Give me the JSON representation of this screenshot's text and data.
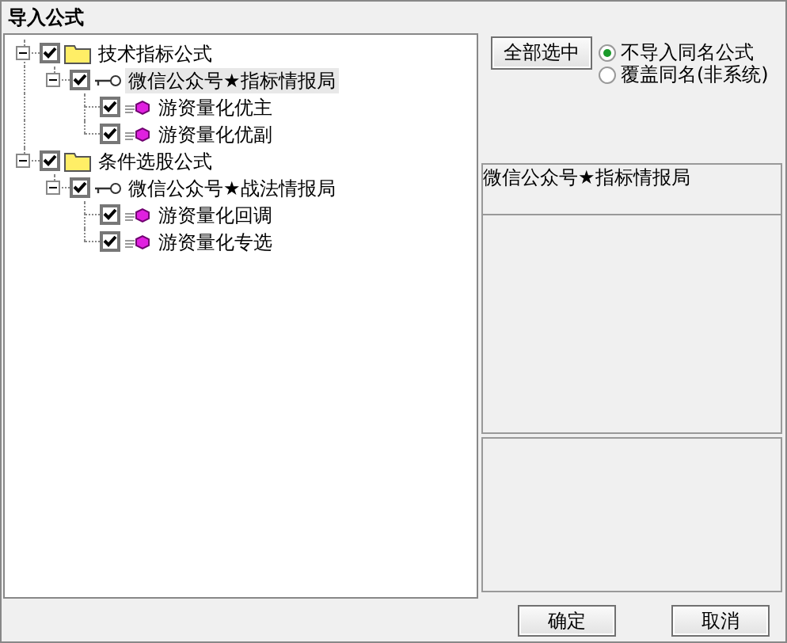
{
  "window": {
    "title": "导入公式"
  },
  "tree": [
    {
      "label": "技术指标公式",
      "kind": "folder",
      "checked": true,
      "expanded": true,
      "selected": false,
      "children": [
        {
          "label": "微信公众号★指标情报局",
          "kind": "group",
          "checked": true,
          "expanded": true,
          "selected": true,
          "children": [
            {
              "label": "游资量化优主",
              "kind": "formula",
              "checked": true,
              "selected": false
            },
            {
              "label": "游资量化优副",
              "kind": "formula",
              "checked": true,
              "selected": false
            }
          ]
        }
      ]
    },
    {
      "label": "条件选股公式",
      "kind": "folder",
      "checked": true,
      "expanded": true,
      "selected": false,
      "children": [
        {
          "label": "微信公众号★战法情报局",
          "kind": "group",
          "checked": true,
          "expanded": true,
          "selected": false,
          "children": [
            {
              "label": "游资量化回调",
              "kind": "formula",
              "checked": true,
              "selected": false
            },
            {
              "label": "游资量化专选",
              "kind": "formula",
              "checked": true,
              "selected": false
            }
          ]
        }
      ]
    }
  ],
  "select_all_button": "全部选中",
  "options": [
    {
      "label": "不导入同名公式",
      "selected": true
    },
    {
      "label": "覆盖同名(非系统)",
      "selected": false
    }
  ],
  "info_title": "微信公众号★指标情报局",
  "buttons": [
    "确定",
    "取消"
  ]
}
